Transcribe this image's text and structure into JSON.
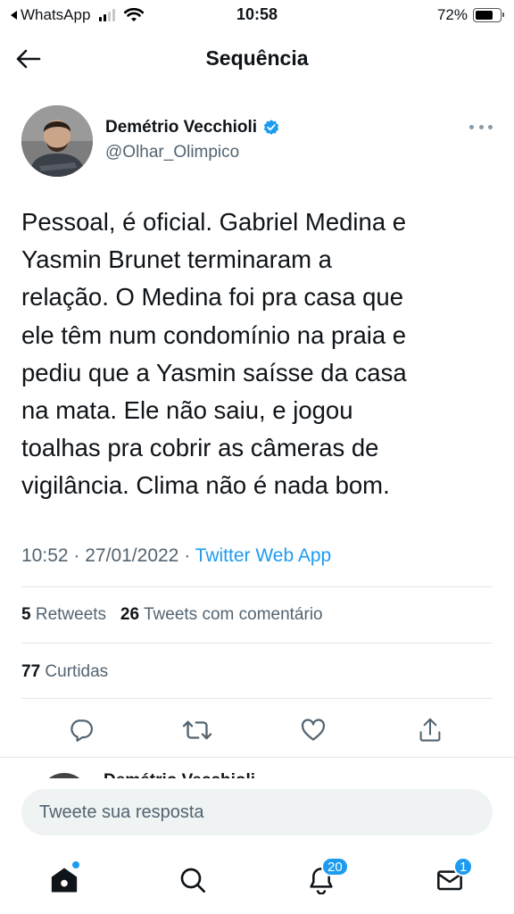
{
  "status_bar": {
    "back_app": "WhatsApp",
    "time": "10:58",
    "battery": "72%",
    "battery_level": 0.72
  },
  "header": {
    "title": "Sequência"
  },
  "tweet": {
    "author_name": "Demétrio Vecchioli",
    "author_handle": "@Olhar_Olimpico",
    "text_lines": [
      "Pessoal, é oficial. Gabriel Medina e",
      "Yasmin Brunet terminaram a",
      "relação. O Medina foi pra casa que",
      "ele têm num condomínio na praia e",
      "pediu que a Yasmin saísse da casa",
      "na mata. Ele não saiu, e jogou",
      "toalhas pra cobrir as câmeras de",
      "vigilância. Clima não é nada bom."
    ],
    "time": "10:52",
    "date": "27/01/2022",
    "source": "Twitter Web App",
    "separator": "·",
    "retweets_count": "5",
    "retweets_label": "Retweets",
    "quotes_count": "26",
    "quotes_label": "Tweets com comentário",
    "likes_count": "77",
    "likes_label": "Curtidas"
  },
  "next_tweet": {
    "author_name_partial": "Demétrio Vecchioli"
  },
  "reply": {
    "placeholder": "Tweete sua resposta"
  },
  "tabbar": {
    "notifications_badge": "20",
    "messages_badge": "1"
  },
  "colors": {
    "accent": "#1d9bf0",
    "text": "#0f1419",
    "secondary": "#536471",
    "divider": "#e1e6ea"
  },
  "icons": {
    "back": "arrow-left-icon",
    "verified": "verified-badge-icon",
    "more": "more-horizontal-icon",
    "reply": "reply-icon",
    "retweet": "retweet-icon",
    "like": "heart-icon",
    "share": "share-icon",
    "home": "home-icon",
    "search": "search-icon",
    "notifications": "bell-icon",
    "messages": "envelope-icon"
  }
}
